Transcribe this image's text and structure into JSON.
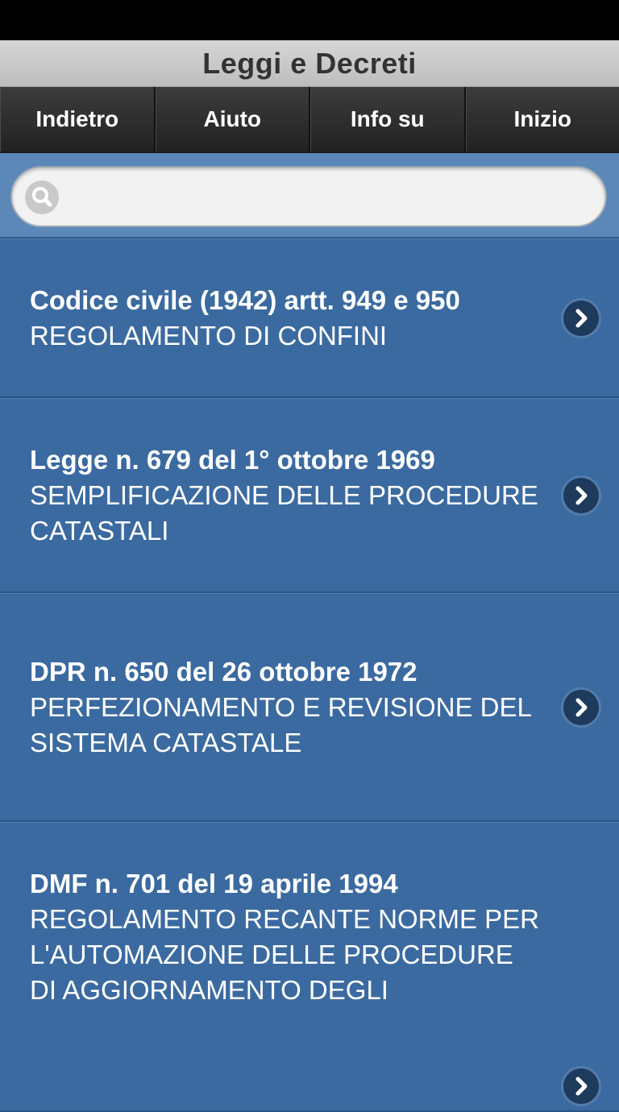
{
  "header": {
    "title": "Leggi e Decreti"
  },
  "nav": {
    "buttons": [
      {
        "label": "Indietro"
      },
      {
        "label": "Aiuto"
      },
      {
        "label": "Info su"
      },
      {
        "label": "Inizio"
      }
    ]
  },
  "search": {
    "placeholder": "",
    "value": ""
  },
  "items": [
    {
      "title": "Codice civile (1942) artt. 949 e 950",
      "subtitle": "REGOLAMENTO DI CONFINI"
    },
    {
      "title": "Legge n. 679 del 1° ottobre 1969",
      "subtitle": "SEMPLIFICAZIONE DELLE PROCEDURE CATASTALI"
    },
    {
      "title": "DPR n. 650 del 26 ottobre 1972",
      "subtitle": "PERFEZIONAMENTO E REVISIONE DEL SISTEMA CATASTALE"
    },
    {
      "title": "DMF n. 701 del 19 aprile 1994",
      "subtitle": "REGOLAMENTO RECANTE NORME PER L'AUTOMAZIONE DELLE PROCEDURE DI AGGIORNAMENTO DEGLI"
    }
  ],
  "colors": {
    "list_bg": "#3b6aa0",
    "nav_bg": "#2b2b2b",
    "title_bar_bg": "#c8c8c8",
    "search_area_bg": "#5b88b8"
  }
}
